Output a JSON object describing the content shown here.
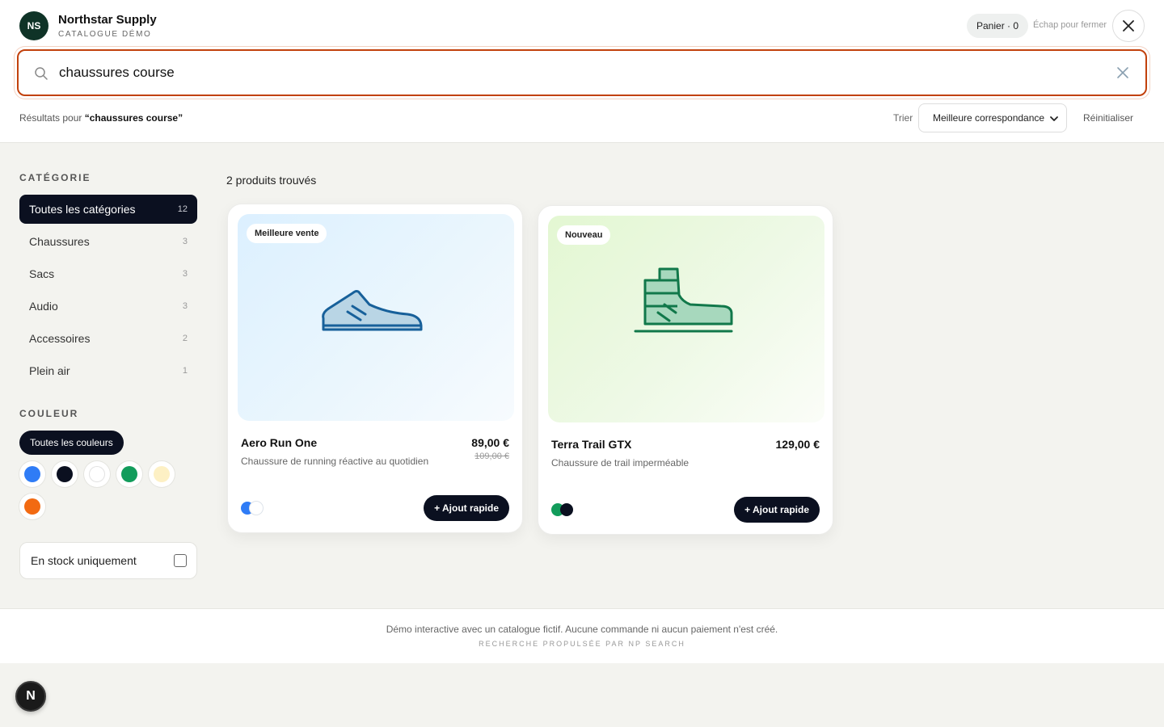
{
  "brand": {
    "initials": "NS",
    "name": "Northstar Supply",
    "subtitle": "CATALOGUE DÉMO"
  },
  "header": {
    "cart_label": "Panier · 0",
    "escape_hint": "Échap pour fermer"
  },
  "search": {
    "query": "chaussures course",
    "placeholder": ""
  },
  "results": {
    "prefix": "Résultats pour ",
    "query_display": "“chaussures course”"
  },
  "sort": {
    "label": "Trier",
    "selected": "Meilleure correspondance",
    "reset_label": "Réinitialiser"
  },
  "sidebar": {
    "category_title": "CATÉGORIE",
    "categories": [
      {
        "label": "Toutes les catégories",
        "count": "12",
        "active": true
      },
      {
        "label": "Chaussures",
        "count": "3"
      },
      {
        "label": "Sacs",
        "count": "3"
      },
      {
        "label": "Audio",
        "count": "3"
      },
      {
        "label": "Accessoires",
        "count": "2"
      },
      {
        "label": "Plein air",
        "count": "1"
      }
    ],
    "color_title": "COULEUR",
    "all_colors_label": "Toutes les couleurs",
    "colors": [
      {
        "name": "blue",
        "hex": "#2f7cf6"
      },
      {
        "name": "black",
        "hex": "#0b1020"
      },
      {
        "name": "white",
        "hex": "#ffffff"
      },
      {
        "name": "green",
        "hex": "#129c5b"
      },
      {
        "name": "cream",
        "hex": "#fdf0c4"
      },
      {
        "name": "orange",
        "hex": "#f26a12"
      }
    ],
    "stock_label": "En stock uniquement"
  },
  "main": {
    "found_label": "2 produits trouvés",
    "products": [
      {
        "tag": "Meilleure vente",
        "name": "Aero Run One",
        "description": "Chaussure de running réactive au quotidien",
        "price": "89,00 €",
        "old_price": "109,00 €",
        "colors": [
          "#2f7cf6",
          "#ffffff"
        ],
        "quick_add": "+ Ajout rapide",
        "icon": "running-shoe-icon"
      },
      {
        "tag": "Nouveau",
        "name": "Terra Trail GTX",
        "description": "Chaussure de trail imperméable",
        "price": "129,00 €",
        "old_price": "",
        "colors": [
          "#129c5b",
          "#0b1020"
        ],
        "quick_add": "+ Ajout rapide",
        "icon": "trail-boot-icon"
      }
    ]
  },
  "footer": {
    "note": "Démo interactive avec un catalogue fictif. Aucune commande ni aucun paiement n'est créé.",
    "sub": "RECHERCHE PROPULSÉE PAR NP SEARCH"
  },
  "fab": {
    "letter": "N"
  },
  "theme": {
    "accent": "#c2410c",
    "dark": "#0b1020",
    "brand": "#0f3327"
  }
}
